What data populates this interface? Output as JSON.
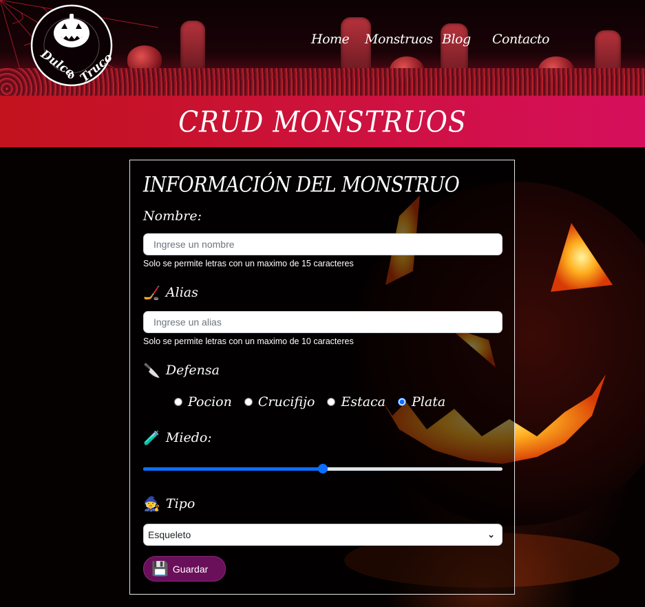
{
  "header": {
    "logo_text": "Dulce o Truco",
    "nav": [
      "Home",
      "Monstruos",
      "Blog",
      "Contacto"
    ]
  },
  "banner": {
    "title": "CRUD MONSTRUOS"
  },
  "form": {
    "title": "INFORMACIÓN DEL MONSTRUO",
    "name": {
      "label": "Nombre:",
      "placeholder": "Ingrese un nombre",
      "value": "",
      "hint": "Solo se permite letras con un maximo de 15 caracteres"
    },
    "alias": {
      "label": "Alias",
      "icon": "hockey-mask-icon",
      "placeholder": "Ingrese un alias",
      "value": "",
      "hint": "Solo se permite letras con un maximo de 10 caracteres"
    },
    "defense": {
      "label": "Defensa",
      "icon": "knife-icon",
      "options": [
        "Pocion",
        "Crucifijo",
        "Estaca",
        "Plata"
      ],
      "selected": "Plata"
    },
    "fear": {
      "label": "Miedo:",
      "icon": "potion-icon",
      "value_fraction": 0.5
    },
    "type": {
      "label": "Tipo",
      "icon": "witch-hat-icon",
      "selected": "Esqueleto"
    },
    "save": {
      "label": "Guardar",
      "icon": "floppy-disk-icon"
    }
  },
  "colors": {
    "band_start": "#c2131e",
    "band_end": "#d60f5c",
    "save_button": "#6a0f5a",
    "accent": "#0d6efd"
  }
}
